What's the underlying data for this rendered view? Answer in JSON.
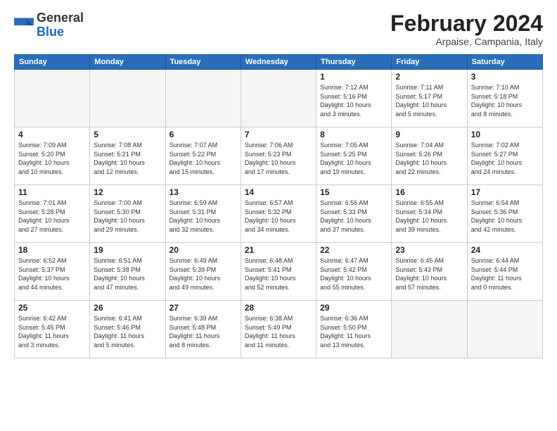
{
  "header": {
    "logo_general": "General",
    "logo_blue": "Blue",
    "month_title": "February 2024",
    "subtitle": "Arpaise, Campania, Italy"
  },
  "weekdays": [
    "Sunday",
    "Monday",
    "Tuesday",
    "Wednesday",
    "Thursday",
    "Friday",
    "Saturday"
  ],
  "weeks": [
    [
      {
        "day": "",
        "info": ""
      },
      {
        "day": "",
        "info": ""
      },
      {
        "day": "",
        "info": ""
      },
      {
        "day": "",
        "info": ""
      },
      {
        "day": "1",
        "info": "Sunrise: 7:12 AM\nSunset: 5:16 PM\nDaylight: 10 hours\nand 3 minutes."
      },
      {
        "day": "2",
        "info": "Sunrise: 7:11 AM\nSunset: 5:17 PM\nDaylight: 10 hours\nand 5 minutes."
      },
      {
        "day": "3",
        "info": "Sunrise: 7:10 AM\nSunset: 5:18 PM\nDaylight: 10 hours\nand 8 minutes."
      }
    ],
    [
      {
        "day": "4",
        "info": "Sunrise: 7:09 AM\nSunset: 5:20 PM\nDaylight: 10 hours\nand 10 minutes."
      },
      {
        "day": "5",
        "info": "Sunrise: 7:08 AM\nSunset: 5:21 PM\nDaylight: 10 hours\nand 12 minutes."
      },
      {
        "day": "6",
        "info": "Sunrise: 7:07 AM\nSunset: 5:22 PM\nDaylight: 10 hours\nand 15 minutes."
      },
      {
        "day": "7",
        "info": "Sunrise: 7:06 AM\nSunset: 5:23 PM\nDaylight: 10 hours\nand 17 minutes."
      },
      {
        "day": "8",
        "info": "Sunrise: 7:05 AM\nSunset: 5:25 PM\nDaylight: 10 hours\nand 19 minutes."
      },
      {
        "day": "9",
        "info": "Sunrise: 7:04 AM\nSunset: 5:26 PM\nDaylight: 10 hours\nand 22 minutes."
      },
      {
        "day": "10",
        "info": "Sunrise: 7:02 AM\nSunset: 5:27 PM\nDaylight: 10 hours\nand 24 minutes."
      }
    ],
    [
      {
        "day": "11",
        "info": "Sunrise: 7:01 AM\nSunset: 5:28 PM\nDaylight: 10 hours\nand 27 minutes."
      },
      {
        "day": "12",
        "info": "Sunrise: 7:00 AM\nSunset: 5:30 PM\nDaylight: 10 hours\nand 29 minutes."
      },
      {
        "day": "13",
        "info": "Sunrise: 6:59 AM\nSunset: 5:31 PM\nDaylight: 10 hours\nand 32 minutes."
      },
      {
        "day": "14",
        "info": "Sunrise: 6:57 AM\nSunset: 5:32 PM\nDaylight: 10 hours\nand 34 minutes."
      },
      {
        "day": "15",
        "info": "Sunrise: 6:56 AM\nSunset: 5:33 PM\nDaylight: 10 hours\nand 37 minutes."
      },
      {
        "day": "16",
        "info": "Sunrise: 6:55 AM\nSunset: 5:34 PM\nDaylight: 10 hours\nand 39 minutes."
      },
      {
        "day": "17",
        "info": "Sunrise: 6:54 AM\nSunset: 5:36 PM\nDaylight: 10 hours\nand 42 minutes."
      }
    ],
    [
      {
        "day": "18",
        "info": "Sunrise: 6:52 AM\nSunset: 5:37 PM\nDaylight: 10 hours\nand 44 minutes."
      },
      {
        "day": "19",
        "info": "Sunrise: 6:51 AM\nSunset: 5:38 PM\nDaylight: 10 hours\nand 47 minutes."
      },
      {
        "day": "20",
        "info": "Sunrise: 6:49 AM\nSunset: 5:39 PM\nDaylight: 10 hours\nand 49 minutes."
      },
      {
        "day": "21",
        "info": "Sunrise: 6:48 AM\nSunset: 5:41 PM\nDaylight: 10 hours\nand 52 minutes."
      },
      {
        "day": "22",
        "info": "Sunrise: 6:47 AM\nSunset: 5:42 PM\nDaylight: 10 hours\nand 55 minutes."
      },
      {
        "day": "23",
        "info": "Sunrise: 6:45 AM\nSunset: 5:43 PM\nDaylight: 10 hours\nand 57 minutes."
      },
      {
        "day": "24",
        "info": "Sunrise: 6:44 AM\nSunset: 5:44 PM\nDaylight: 11 hours\nand 0 minutes."
      }
    ],
    [
      {
        "day": "25",
        "info": "Sunrise: 6:42 AM\nSunset: 5:45 PM\nDaylight: 11 hours\nand 3 minutes."
      },
      {
        "day": "26",
        "info": "Sunrise: 6:41 AM\nSunset: 5:46 PM\nDaylight: 11 hours\nand 5 minutes."
      },
      {
        "day": "27",
        "info": "Sunrise: 6:39 AM\nSunset: 5:48 PM\nDaylight: 11 hours\nand 8 minutes."
      },
      {
        "day": "28",
        "info": "Sunrise: 6:38 AM\nSunset: 5:49 PM\nDaylight: 11 hours\nand 11 minutes."
      },
      {
        "day": "29",
        "info": "Sunrise: 6:36 AM\nSunset: 5:50 PM\nDaylight: 11 hours\nand 13 minutes."
      },
      {
        "day": "",
        "info": ""
      },
      {
        "day": "",
        "info": ""
      }
    ]
  ]
}
